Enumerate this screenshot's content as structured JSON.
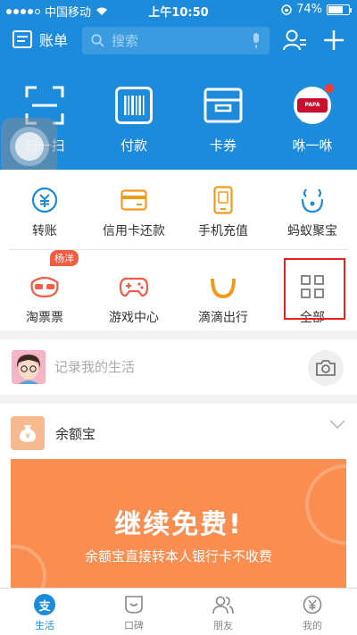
{
  "status_bar": {
    "carrier": "中国移动",
    "time": "上午10:50",
    "battery": "74%",
    "battery_level": 0.74
  },
  "header": {
    "bill_label": "账单",
    "search_placeholder": "搜索"
  },
  "quick_actions": [
    {
      "label": "扫一扫",
      "icon": "scan-icon"
    },
    {
      "label": "付款",
      "icon": "barcode-icon"
    },
    {
      "label": "卡券",
      "icon": "wallet-icon"
    },
    {
      "label": "咻一咻",
      "icon": "papa-johns-logo"
    }
  ],
  "services_row1": [
    {
      "label": "转账",
      "icon": "transfer-icon"
    },
    {
      "label": "信用卡还款",
      "icon": "credit-card-icon"
    },
    {
      "label": "手机充值",
      "icon": "phone-recharge-icon"
    },
    {
      "label": "蚂蚁聚宝",
      "icon": "ant-fortune-icon"
    }
  ],
  "services_row2": [
    {
      "label": "淘票票",
      "icon": "glasses-icon",
      "badge": "杨洋"
    },
    {
      "label": "游戏中心",
      "icon": "gamepad-icon"
    },
    {
      "label": "滴滴出行",
      "icon": "didi-icon"
    },
    {
      "label": "全部",
      "icon": "grid-icon"
    }
  ],
  "record": {
    "text": "记录我的生活"
  },
  "yuebao": {
    "title": "余额宝",
    "banner_title": "继续免费!",
    "banner_subtitle": "余额宝直接转本人银行卡不收费"
  },
  "tabs": [
    {
      "label": "生活",
      "icon": "alipay-icon",
      "active": true
    },
    {
      "label": "口碑",
      "icon": "koubei-icon"
    },
    {
      "label": "朋友",
      "icon": "friends-icon"
    },
    {
      "label": "我的",
      "icon": "yuan-icon"
    }
  ],
  "colors": {
    "primary_blue": "#1d8bdc",
    "service_orange": "#f39a1d",
    "service_blue": "#1d8bdc",
    "banner_orange": "#fa8d50",
    "highlight_red": "#e8201d"
  }
}
